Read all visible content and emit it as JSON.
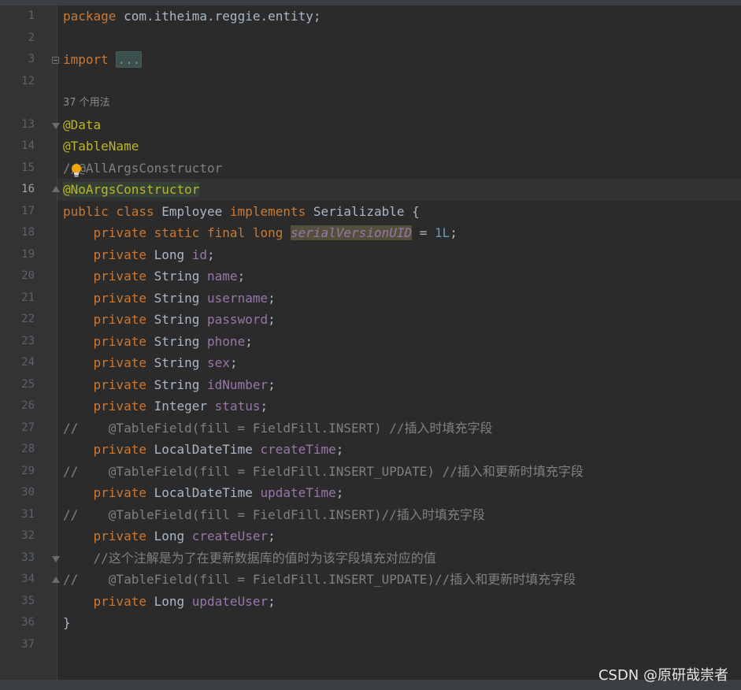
{
  "editor": {
    "lines": [
      {
        "n": "1",
        "text": "package com.itheima.reggie.entity;"
      },
      {
        "n": "2",
        "text": ""
      },
      {
        "n": "3",
        "text": "import ..."
      },
      {
        "n": "12",
        "text": ""
      },
      {
        "n": "13",
        "text": "@Data"
      },
      {
        "n": "14",
        "text": "@TableName"
      },
      {
        "n": "15",
        "text": "//@AllArgsConstructor"
      },
      {
        "n": "16",
        "text": "@NoArgsConstructor"
      },
      {
        "n": "17",
        "text": "public class Employee implements Serializable {"
      },
      {
        "n": "18",
        "text": "private static final long serialVersionUID = 1L;"
      },
      {
        "n": "19",
        "text": "private Long id;"
      },
      {
        "n": "20",
        "text": "private String name;"
      },
      {
        "n": "21",
        "text": "private String username;"
      },
      {
        "n": "22",
        "text": "private String password;"
      },
      {
        "n": "23",
        "text": "private String phone;"
      },
      {
        "n": "24",
        "text": "private String sex;"
      },
      {
        "n": "25",
        "text": "private String idNumber;"
      },
      {
        "n": "26",
        "text": "private Integer status;"
      },
      {
        "n": "27",
        "text": "//    @TableField(fill = FieldFill.INSERT) //插入时填充字段"
      },
      {
        "n": "28",
        "text": "private LocalDateTime createTime;"
      },
      {
        "n": "29",
        "text": "//    @TableField(fill = FieldFill.INSERT_UPDATE) //插入和更新时填充字段"
      },
      {
        "n": "30",
        "text": "private LocalDateTime updateTime;"
      },
      {
        "n": "31",
        "text": "//    @TableField(fill = FieldFill.INSERT)//插入时填充字段"
      },
      {
        "n": "32",
        "text": "private Long createUser;"
      },
      {
        "n": "33",
        "text": "//这个注解是为了在更新数据库的值时为该字段填充对应的值"
      },
      {
        "n": "34",
        "text": "//    @TableField(fill = FieldFill.INSERT_UPDATE)//插入和更新时填充字段"
      },
      {
        "n": "35",
        "text": "private Long updateUser;"
      },
      {
        "n": "36",
        "text": "}"
      },
      {
        "n": "37",
        "text": ""
      }
    ],
    "usage_hint": "37 个用法",
    "current_line": "16"
  },
  "watermark": "CSDN @原研哉崇者",
  "colors": {
    "background": "#2b2b2b",
    "keyword": "#cc7832",
    "annotation": "#bbb529",
    "field": "#9876aa",
    "number": "#6897bb",
    "comment": "#808080",
    "text": "#a9b7c6"
  }
}
